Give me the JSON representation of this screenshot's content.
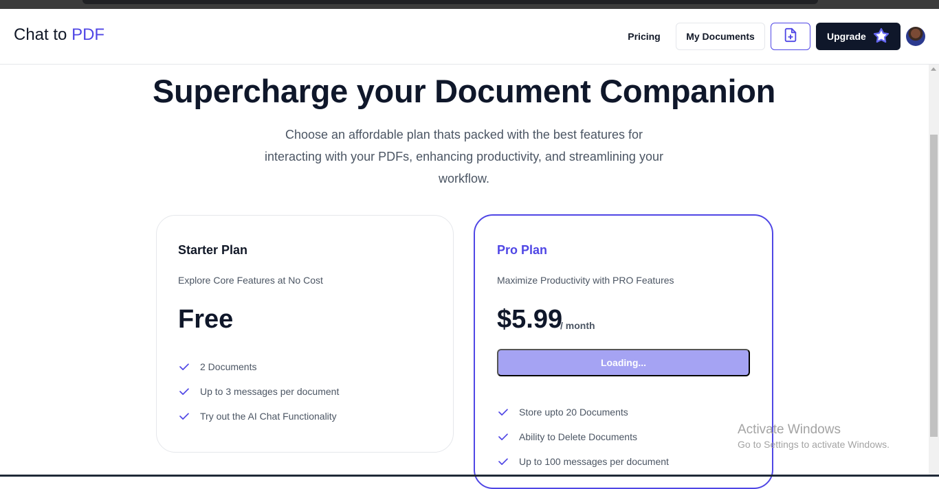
{
  "brand": {
    "prefix": "Chat to",
    "accent": "PDF",
    "accent_color": "#4f46e5"
  },
  "nav": {
    "pricing_label": "Pricing",
    "documents_label": "My Documents",
    "new_document_icon": "file-plus-icon",
    "upgrade_label": "Upgrade",
    "upgrade_icon": "star-icon",
    "avatar": "user-avatar"
  },
  "hero": {
    "title": "Supercharge your Document Companion",
    "subtitle": "Choose an affordable plan thats packed with the best features for interacting with your PDFs, enhancing productivity, and streamlining your workflow."
  },
  "plans": {
    "starter": {
      "name": "Starter Plan",
      "description": "Explore Core Features at No Cost",
      "price": "Free",
      "features": [
        "2 Documents",
        "Up to 3 messages per document",
        "Try out the AI Chat Functionality"
      ]
    },
    "pro": {
      "name": "Pro Plan",
      "description": "Maximize Productivity with PRO Features",
      "price": "$5.99",
      "period": "/ month",
      "button_label": "Loading...",
      "features": [
        "Store upto 20 Documents",
        "Ability to Delete Documents",
        "Up to 100 messages per document"
      ]
    }
  },
  "os_watermark": {
    "title": "Activate Windows",
    "subtitle": "Go to Settings to activate Windows."
  },
  "colors": {
    "primary": "#4f46e5",
    "dark": "#0f172a",
    "loading_button": "#a5a3f3"
  }
}
